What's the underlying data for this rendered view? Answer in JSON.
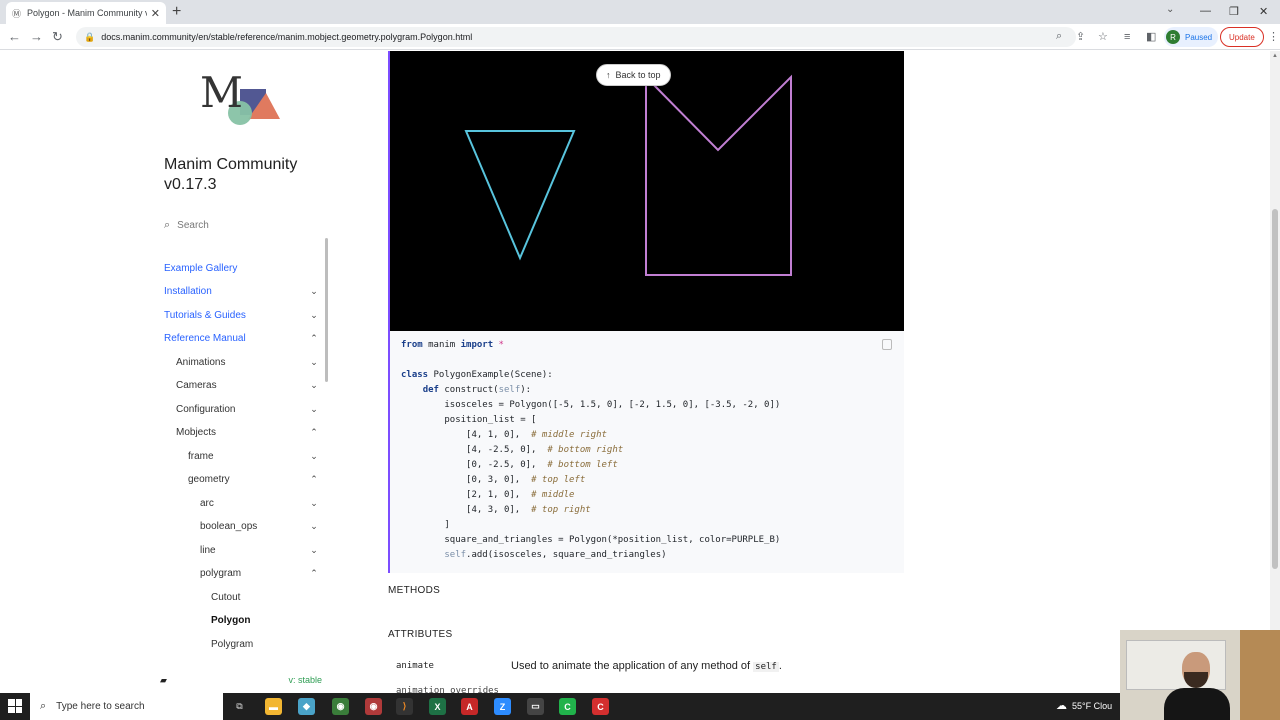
{
  "browser": {
    "tab_title": "Polygon - Manim Community v",
    "url": "docs.manim.community/en/stable/reference/manim.mobject.geometry.polygram.Polygon.html",
    "profile_status": "Paused",
    "profile_initial": "R",
    "update_label": "Update"
  },
  "sidebar": {
    "brand_line1": "Manim Community",
    "brand_line2": "v0.17.3",
    "search_placeholder": "Search",
    "items": [
      {
        "label": "Example Gallery"
      },
      {
        "label": "Installation"
      },
      {
        "label": "Tutorials & Guides"
      },
      {
        "label": "Reference Manual"
      },
      {
        "label": "Animations"
      },
      {
        "label": "Cameras"
      },
      {
        "label": "Configuration"
      },
      {
        "label": "Mobjects"
      },
      {
        "label": "frame"
      },
      {
        "label": "geometry"
      },
      {
        "label": "arc"
      },
      {
        "label": "boolean_ops"
      },
      {
        "label": "line"
      },
      {
        "label": "polygram"
      },
      {
        "label": "Cutout"
      },
      {
        "label": "Polygon"
      },
      {
        "label": "Polygram"
      }
    ],
    "version_label": "v: stable"
  },
  "main": {
    "back_to_top": "Back to top",
    "code": {
      "l1_kw": "from",
      "l1_mod": " manim ",
      "l1_imp": "import",
      "l1_star": " *",
      "l3_kw": "class",
      "l3_rest": " PolygonExample(Scene):",
      "l4_kw": "def",
      "l4_rest": " construct(",
      "l4_self": "self",
      "l4_end": "):",
      "l5": "isosceles = Polygon([-5, 1.5, 0], [-2, 1.5, 0], [-3.5, -2, 0])",
      "l6": "position_list = [",
      "rows": [
        {
          "code": "[4, 1, 0],  ",
          "comment": "# middle right"
        },
        {
          "code": "[4, -2.5, 0],  ",
          "comment": "# bottom right"
        },
        {
          "code": "[0, -2.5, 0],  ",
          "comment": "# bottom left"
        },
        {
          "code": "[0, 3, 0],  ",
          "comment": "# top left"
        },
        {
          "code": "[2, 1, 0],  ",
          "comment": "# middle"
        },
        {
          "code": "[4, 3, 0],  ",
          "comment": "# top right"
        }
      ],
      "l13": "]",
      "l14": "square_and_triangles = Polygon(*position_list, color=PURPLE_B)",
      "l15_self": "self",
      "l15_rest": ".add(isosceles, square_and_triangles)"
    },
    "methods_heading": "METHODS",
    "attributes_heading": "ATTRIBUTES",
    "attr_name": "animate",
    "attr_desc": "Used to animate the application of any method of ",
    "attr_desc_code": "self",
    "attr_desc_end": ".",
    "attr_next": "animation_overrides"
  },
  "taskbar": {
    "search_placeholder": "Type here to search",
    "weather": "55°F  Clou"
  },
  "colors": {
    "link": "#2962ff",
    "triangle": "#58c4dd",
    "polygon": "#c17fd3"
  }
}
